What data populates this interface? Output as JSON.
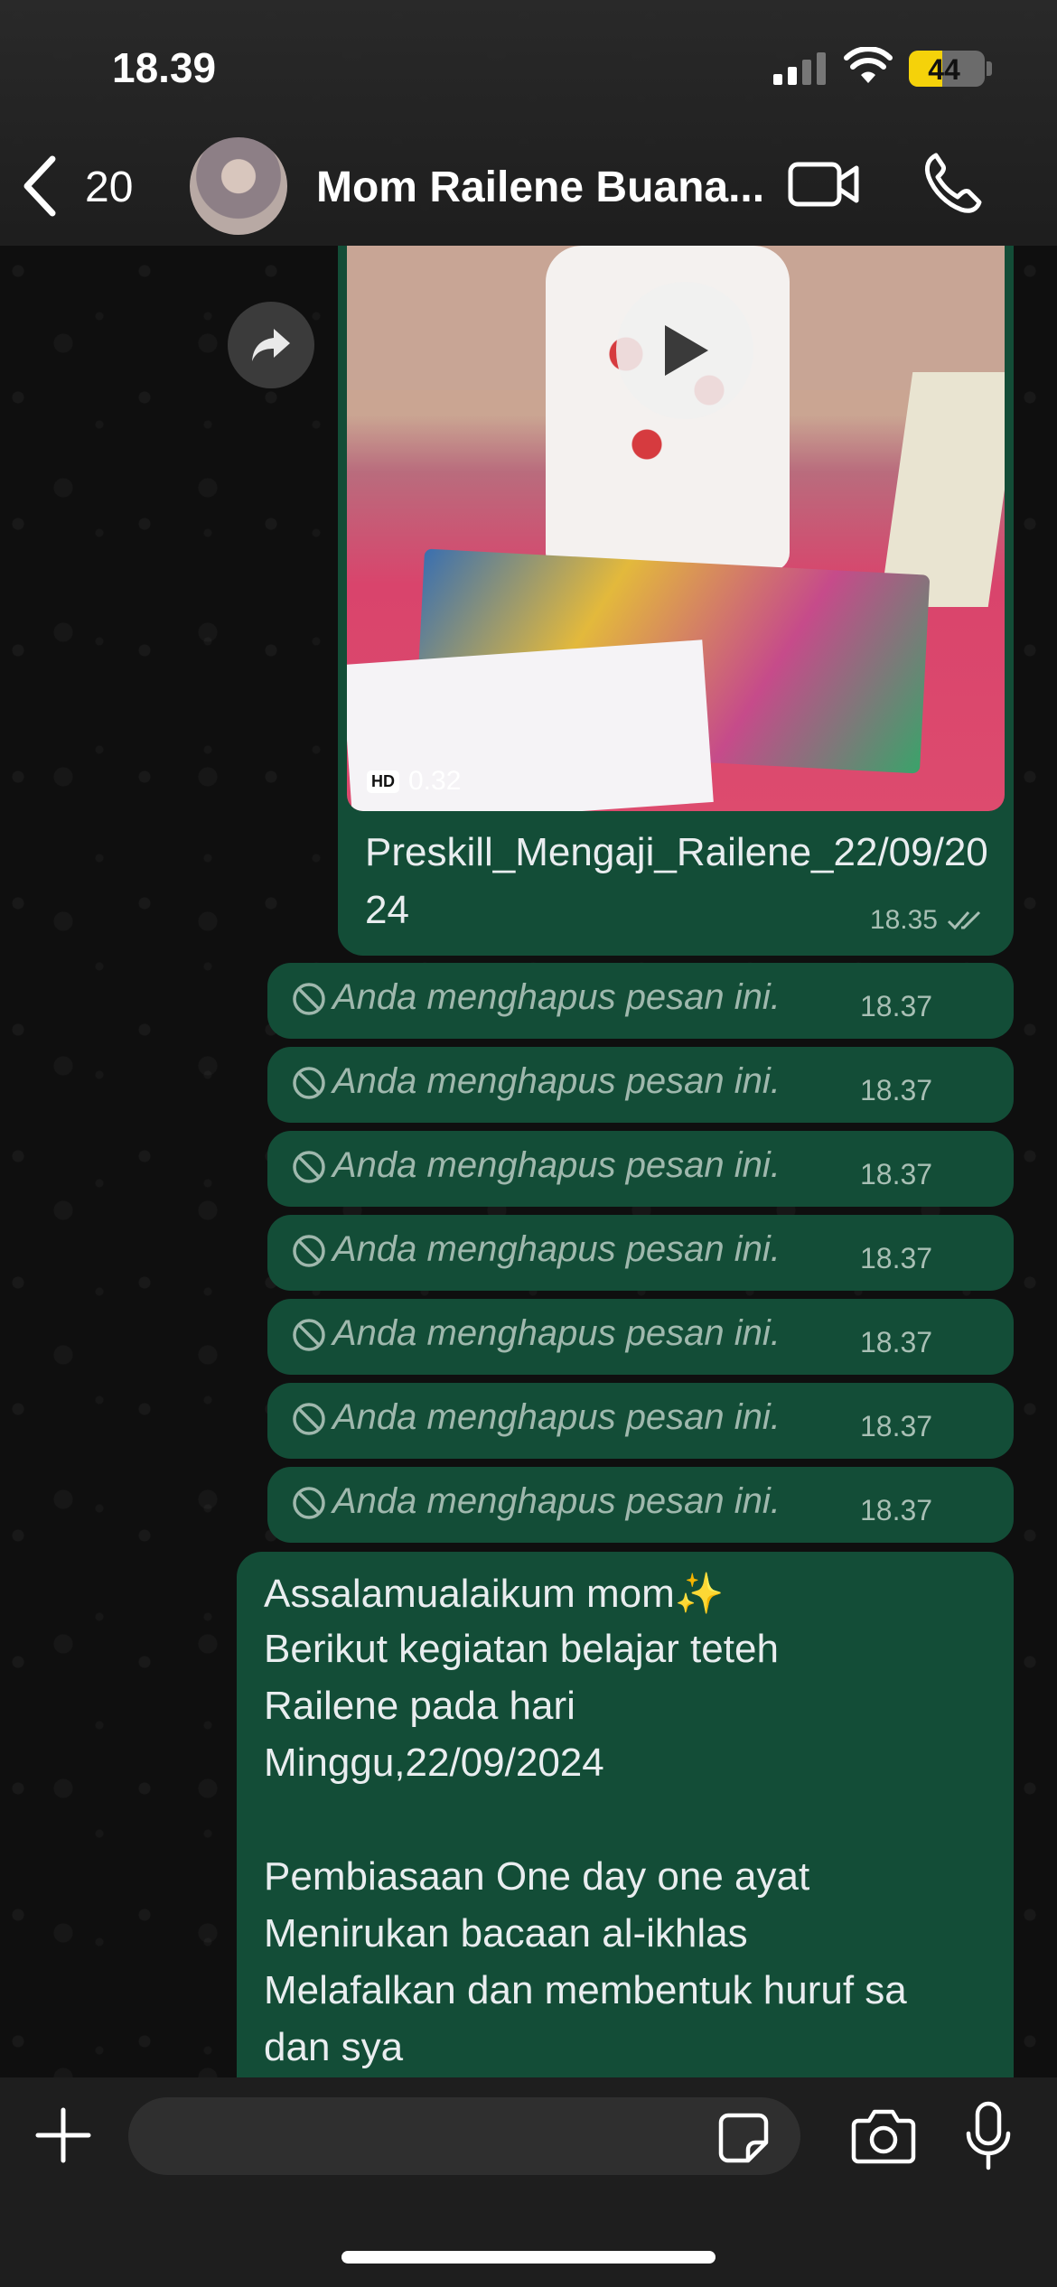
{
  "status_bar": {
    "time": "18.39",
    "battery_level": "44"
  },
  "header": {
    "back_count": "20",
    "chat_title": "Mom Railene Buana..."
  },
  "video_message": {
    "duration": "0.32",
    "hd_label": "HD",
    "caption": "Preskill_Mengaji_Railene_22/09/2024",
    "time": "18.35"
  },
  "deleted_messages": [
    {
      "text": "Anda menghapus pesan ini.",
      "time": "18.37"
    },
    {
      "text": "Anda menghapus pesan ini.",
      "time": "18.37"
    },
    {
      "text": "Anda menghapus pesan ini.",
      "time": "18.37"
    },
    {
      "text": "Anda menghapus pesan ini.",
      "time": "18.37"
    },
    {
      "text": "Anda menghapus pesan ini.",
      "time": "18.37"
    },
    {
      "text": "Anda menghapus pesan ini.",
      "time": "18.37"
    },
    {
      "text": "Anda menghapus pesan ini.",
      "time": "18.37"
    }
  ],
  "text_message": {
    "lines": [
      "Assalamualaikum mom✨",
      "Berikut kegiatan belajar teteh",
      "Railene pada hari",
      "Minggu,22/09/2024",
      "",
      "Pembiasaan One day one ayat",
      "Menirukan bacaan al-ikhlas",
      "Melafalkan dan membentuk huruf sa",
      "dan sya"
    ]
  },
  "colors": {
    "bubble_outgoing": "#134d37",
    "read_ticks": "#a8bfb4",
    "battery_fill": "#f5d20a"
  }
}
